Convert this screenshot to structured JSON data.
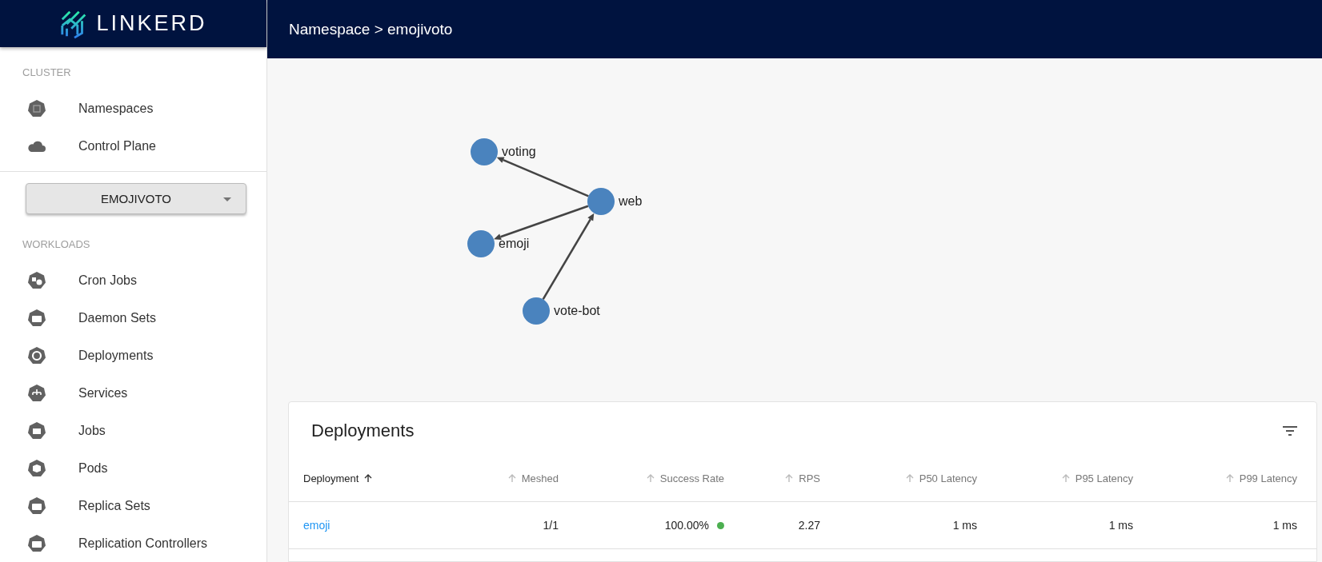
{
  "brand": {
    "name": "LINKERD"
  },
  "header": {
    "breadcrumb": "Namespace > emojivoto"
  },
  "sidebar": {
    "sections": [
      {
        "heading": "CLUSTER",
        "items": [
          {
            "label": "Namespaces"
          },
          {
            "label": "Control Plane"
          }
        ]
      },
      {
        "namespace_select": "EMOJIVOTO"
      },
      {
        "heading": "WORKLOADS",
        "items": [
          {
            "label": "Cron Jobs"
          },
          {
            "label": "Daemon Sets"
          },
          {
            "label": "Deployments"
          },
          {
            "label": "Services"
          },
          {
            "label": "Jobs"
          },
          {
            "label": "Pods"
          },
          {
            "label": "Replica Sets"
          },
          {
            "label": "Replication Controllers"
          }
        ]
      }
    ]
  },
  "graph": {
    "nodes": [
      {
        "label": "voting"
      },
      {
        "label": "web"
      },
      {
        "label": "emoji"
      },
      {
        "label": "vote-bot"
      }
    ]
  },
  "table": {
    "title": "Deployments",
    "columns": [
      {
        "label": "Deployment",
        "sorted": true
      },
      {
        "label": "Meshed",
        "sorted": false
      },
      {
        "label": "Success Rate",
        "sorted": false
      },
      {
        "label": "RPS",
        "sorted": false
      },
      {
        "label": "P50 Latency",
        "sorted": false
      },
      {
        "label": "P95 Latency",
        "sorted": false
      },
      {
        "label": "P99 Latency",
        "sorted": false
      }
    ],
    "rows": [
      {
        "name": "emoji",
        "meshed": "1/1",
        "success_rate": "100.00%",
        "color": "#4caf50",
        "rps": "2.27",
        "p50": "1 ms",
        "p95": "1 ms",
        "p99": "1 ms"
      }
    ]
  }
}
